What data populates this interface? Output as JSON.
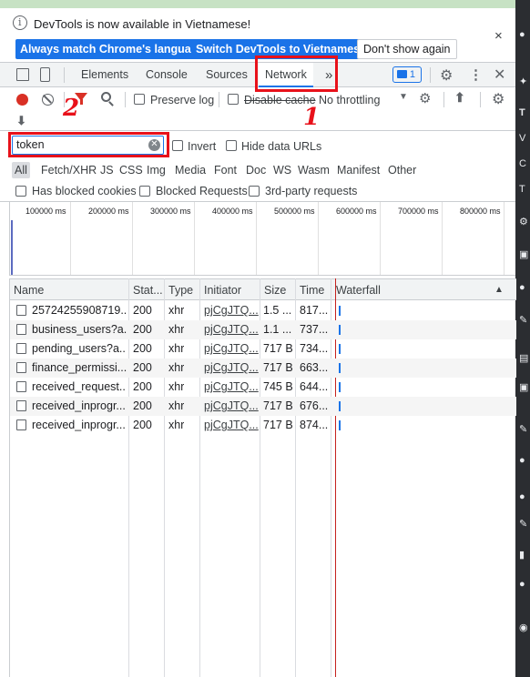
{
  "infobar": {
    "message": "DevTools is now available in Vietnamese!",
    "btn_match": "Always match Chrome's language",
    "btn_switch": "Switch DevTools to Vietnamese",
    "btn_dont_show": "Don't show again",
    "close": "×"
  },
  "tabs": {
    "elements": "Elements",
    "console": "Console",
    "sources": "Sources",
    "network": "Network",
    "more": "»",
    "issues_count": "1"
  },
  "toolbar": {
    "preserve_log": "Preserve log",
    "disable_cache": "Disable cache",
    "throttling": "No throttling"
  },
  "filter": {
    "value": "token",
    "invert": "Invert",
    "hide_data_urls": "Hide data URLs"
  },
  "types": [
    "All",
    "Fetch/XHR",
    "JS",
    "CSS",
    "Img",
    "Media",
    "Font",
    "Doc",
    "WS",
    "Wasm",
    "Manifest",
    "Other"
  ],
  "blocked": {
    "blocked_cookies": "Has blocked cookies",
    "blocked_requests": "Blocked Requests",
    "third_party": "3rd-party requests"
  },
  "overview_ticks": [
    "100000 ms",
    "200000 ms",
    "300000 ms",
    "400000 ms",
    "500000 ms",
    "600000 ms",
    "700000 ms",
    "800000 ms"
  ],
  "table": {
    "headers": {
      "name": "Name",
      "status": "Stat...",
      "type": "Type",
      "initiator": "Initiator",
      "size": "Size",
      "time": "Time",
      "waterfall": "Waterfall"
    },
    "rows": [
      {
        "name": "25724255908719...",
        "status": "200",
        "type": "xhr",
        "initiator": "pjCgJTQ...",
        "size": "1.5 ...",
        "time": "817..."
      },
      {
        "name": "business_users?a...",
        "status": "200",
        "type": "xhr",
        "initiator": "pjCgJTQ...",
        "size": "1.1 ...",
        "time": "737..."
      },
      {
        "name": "pending_users?a...",
        "status": "200",
        "type": "xhr",
        "initiator": "pjCgJTQ...",
        "size": "717 B",
        "time": "734..."
      },
      {
        "name": "finance_permissi...",
        "status": "200",
        "type": "xhr",
        "initiator": "pjCgJTQ...",
        "size": "717 B",
        "time": "663..."
      },
      {
        "name": "received_request...",
        "status": "200",
        "type": "xhr",
        "initiator": "pjCgJTQ...",
        "size": "745 B",
        "time": "644..."
      },
      {
        "name": "received_inprogr...",
        "status": "200",
        "type": "xhr",
        "initiator": "pjCgJTQ...",
        "size": "717 B",
        "time": "676..."
      },
      {
        "name": "received_inprogr...",
        "status": "200",
        "type": "xhr",
        "initiator": "pjCgJTQ...",
        "size": "717 B",
        "time": "874..."
      }
    ]
  },
  "annotations": {
    "one": "1",
    "two": "2"
  },
  "colors": {
    "accent": "#1a73e8",
    "record": "#d93025",
    "annotation": "#e8111a"
  }
}
